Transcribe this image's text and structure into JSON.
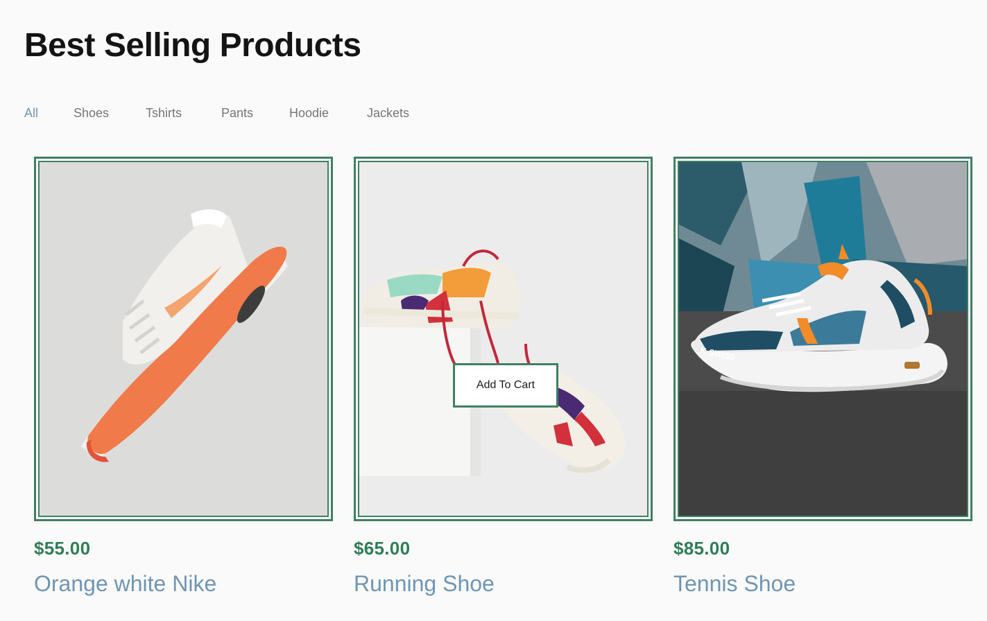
{
  "heading": "Best Selling Products",
  "filters": [
    "All",
    "Shoes",
    "Tshirts",
    "Pants",
    "Hoodie",
    "Jackets"
  ],
  "active_filter": "All",
  "products": [
    {
      "price": "$55.00",
      "name": "Orange white Nike"
    },
    {
      "price": "$65.00",
      "name": "Running Shoe"
    },
    {
      "price": "$85.00",
      "name": "Tennis Shoe"
    }
  ],
  "add_to_cart_label": "Add To Cart",
  "brand_logo_text": "K-SWISS",
  "colors": {
    "accent_green": "#3f7f63",
    "price_green": "#2f7d57",
    "name_blue": "#6f95b3",
    "active_filter": "#6f95b3",
    "title": "#141414"
  }
}
